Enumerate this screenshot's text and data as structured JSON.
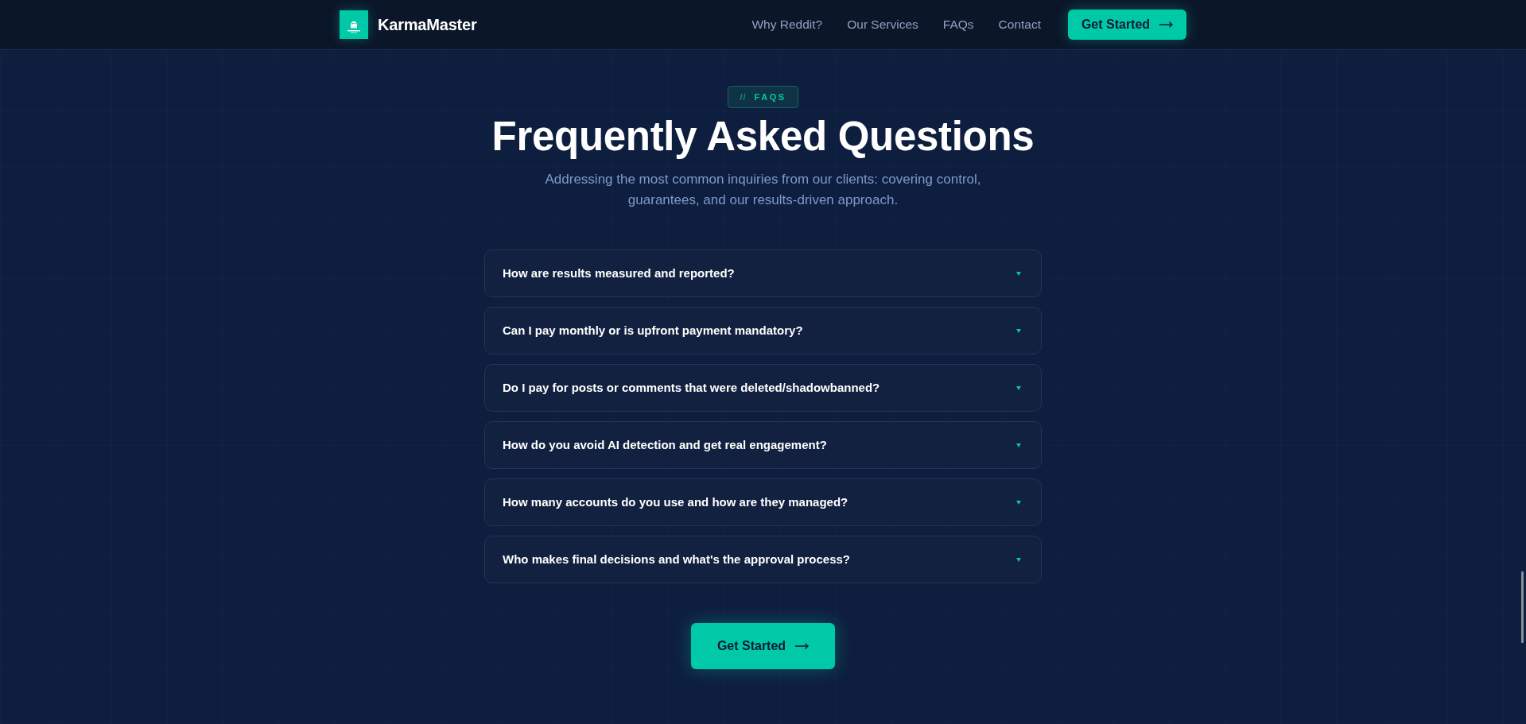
{
  "header": {
    "logo": {
      "name": "KarmaMaster"
    },
    "nav": [
      {
        "label": "Why Reddit?"
      },
      {
        "label": "Our Services"
      },
      {
        "label": "FAQs"
      },
      {
        "label": "Contact"
      }
    ],
    "cta": {
      "label": "Get Started"
    }
  },
  "faq_section": {
    "eyebrow": {
      "prefix": "//",
      "label": "FAQS"
    },
    "title": "Frequently Asked Questions",
    "subtitle": "Addressing the most common inquiries from our clients: covering control, guarantees, and our results-driven approach.",
    "items": [
      {
        "question": "How are results measured and reported?",
        "expanded": false
      },
      {
        "question": "Can I pay monthly or is upfront payment mandatory?",
        "expanded": false
      },
      {
        "question": "Do I pay for posts or comments that were deleted/shadowbanned?",
        "expanded": false
      },
      {
        "question": "How do you avoid AI detection and get real engagement?",
        "expanded": false
      },
      {
        "question": "How many accounts do you use and how are they managed?",
        "expanded": false
      },
      {
        "question": "Who makes final decisions and what's the approval process?",
        "expanded": false
      }
    ],
    "cta": {
      "label": "Get Started"
    }
  }
}
